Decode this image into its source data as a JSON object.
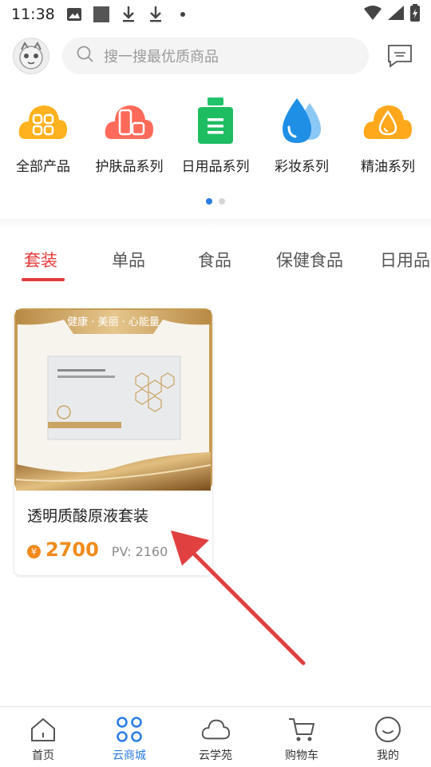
{
  "status_bar": {
    "time": "11:38"
  },
  "search": {
    "placeholder": "搜一搜最优质商品"
  },
  "categories": [
    {
      "label": "全部产品",
      "icon": "all-products-icon"
    },
    {
      "label": "护肤品系列",
      "icon": "skincare-icon"
    },
    {
      "label": "日用品系列",
      "icon": "daily-goods-icon"
    },
    {
      "label": "彩妆系列",
      "icon": "makeup-drop-icon"
    },
    {
      "label": "精油系列",
      "icon": "essential-oil-icon"
    }
  ],
  "carousel": {
    "pages": 2,
    "active": 1
  },
  "tabs": [
    {
      "label": "套装",
      "active": true
    },
    {
      "label": "单品"
    },
    {
      "label": "食品"
    },
    {
      "label": "保健食品"
    },
    {
      "label": "日用品"
    }
  ],
  "product": {
    "banner_text": "健康 · 美丽 · 心能量",
    "name": "透明质酸原液套装",
    "currency": "¥",
    "price": "2700",
    "pv": "PV: 2160"
  },
  "bottom_nav": [
    {
      "label": "首页",
      "icon": "home-icon"
    },
    {
      "label": "云商城",
      "icon": "mall-grid-icon",
      "active": true
    },
    {
      "label": "云学苑",
      "icon": "cloud-icon"
    },
    {
      "label": "购物车",
      "icon": "cart-icon"
    },
    {
      "label": "我的",
      "icon": "profile-face-icon"
    }
  ],
  "colors": {
    "accent_blue": "#2a7de1",
    "tab_red": "#e53a3a",
    "price_orange": "#f08a1c",
    "gold": "#c79b53"
  }
}
